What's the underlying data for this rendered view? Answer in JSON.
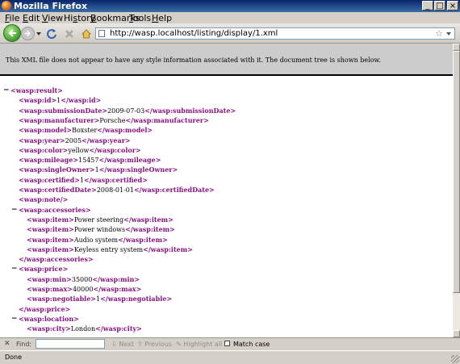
{
  "window": {
    "title": "Mozilla Firefox"
  },
  "menu": [
    {
      "accel": "F",
      "rest": "ile"
    },
    {
      "accel": "E",
      "rest": "dit"
    },
    {
      "accel": "V",
      "rest": "iew"
    },
    {
      "pre": "Hi",
      "accel": "s",
      "rest": "tory"
    },
    {
      "accel": "B",
      "rest": "ookmarks"
    },
    {
      "accel": "T",
      "rest": "ools"
    },
    {
      "accel": "H",
      "rest": "elp"
    }
  ],
  "address": {
    "url": "http://wasp.localhost/listing/display/1.xml"
  },
  "xml_notice": "This XML file does not appear to have any style information associated with it. The document tree is shown below.",
  "xml_lines": [
    {
      "indent": 0,
      "collapse": true,
      "open": "<wasp:result>"
    },
    {
      "indent": 1,
      "open": "<wasp:id>",
      "text": "1",
      "close": "</wasp:id>"
    },
    {
      "indent": 1,
      "open": "<wasp:submissionDate>",
      "text": "2009-07-03",
      "close": "</wasp:submissionDate>"
    },
    {
      "indent": 1,
      "open": "<wasp:manufacturer>",
      "text": "Porsche",
      "close": "</wasp:manufacturer>"
    },
    {
      "indent": 1,
      "open": "<wasp:model>",
      "text": "Boxster",
      "close": "</wasp:model>"
    },
    {
      "indent": 1,
      "open": "<wasp:year>",
      "text": "2005",
      "close": "</wasp:year>"
    },
    {
      "indent": 1,
      "open": "<wasp:color>",
      "text": "yellow",
      "close": "</wasp:color>"
    },
    {
      "indent": 1,
      "open": "<wasp:mileage>",
      "text": "15457",
      "close": "</wasp:mileage>"
    },
    {
      "indent": 1,
      "open": "<wasp:singleOwner>",
      "text": "1",
      "close": "</wasp:singleOwner>"
    },
    {
      "indent": 1,
      "open": "<wasp:certified>",
      "text": "1",
      "close": "</wasp:certified>"
    },
    {
      "indent": 1,
      "open": "<wasp:certifiedDate>",
      "text": "2008-01-01",
      "close": "</wasp:certifiedDate>"
    },
    {
      "indent": 1,
      "open": "<wasp:note/>"
    },
    {
      "indent": 1,
      "collapse": true,
      "open": "<wasp:accessories>"
    },
    {
      "indent": 2,
      "open": "<wasp:item>",
      "text": "Power steering",
      "close": "</wasp:item>"
    },
    {
      "indent": 2,
      "open": "<wasp:item>",
      "text": "Power windows",
      "close": "</wasp:item>"
    },
    {
      "indent": 2,
      "open": "<wasp:item>",
      "text": "Audio system",
      "close": "</wasp:item>"
    },
    {
      "indent": 2,
      "open": "<wasp:item>",
      "text": "Keyless entry system",
      "close": "</wasp:item>"
    },
    {
      "indent": 1,
      "open": "</wasp:accessories>"
    },
    {
      "indent": 1,
      "collapse": true,
      "open": "<wasp:price>"
    },
    {
      "indent": 2,
      "open": "<wasp:min>",
      "text": "35000",
      "close": "</wasp:min>"
    },
    {
      "indent": 2,
      "open": "<wasp:max>",
      "text": "40000",
      "close": "</wasp:max>"
    },
    {
      "indent": 2,
      "open": "<wasp:negotiable>",
      "text": "1",
      "close": "</wasp:negotiable>"
    },
    {
      "indent": 1,
      "open": "</wasp:price>"
    },
    {
      "indent": 1,
      "collapse": true,
      "open": "<wasp:location>"
    },
    {
      "indent": 2,
      "open": "<wasp:city>",
      "text": "London",
      "close": "</wasp:city>"
    }
  ],
  "findbar": {
    "label": "Find:",
    "next": "Next",
    "previous": "Previous",
    "highlight": "Highlight all",
    "match_case": "Match case"
  },
  "status": "Done"
}
